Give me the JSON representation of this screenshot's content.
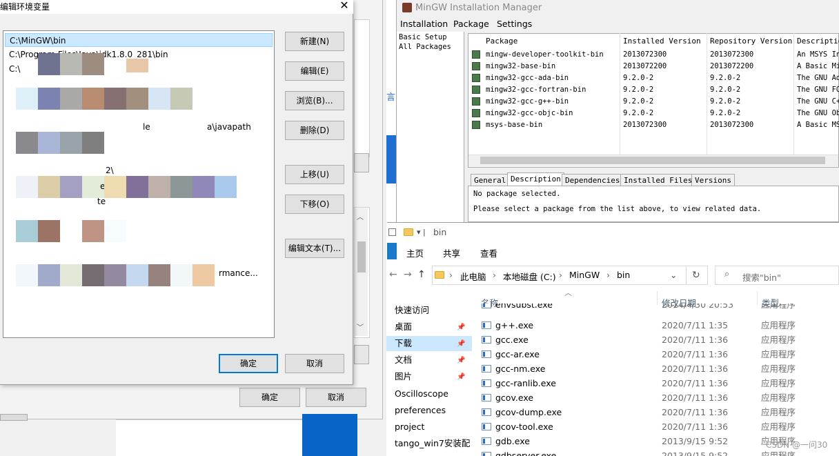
{
  "env_dialog": {
    "title": "编辑环境变量",
    "close_glyph": "✕",
    "paths": [
      "C:\\MinGW\\bin",
      "C:\\Program Files\\Java\\jdk1.8.0_281\\bin",
      "C:\\"
    ],
    "fragments": [
      "le",
      "a\\javapath",
      "2\\",
      "em",
      "te",
      "rmance..."
    ],
    "buttons": {
      "new": "新建(N)",
      "edit": "编辑(E)",
      "browse": "浏览(B)...",
      "delete": "删除(D)",
      "move_up": "上移(U)",
      "move_down": "下移(O)",
      "edit_text": "编辑文本(T)..."
    },
    "ok": "确定",
    "cancel": "取消"
  },
  "bg_dialog": {
    "ok": "确定",
    "cancel": "取消",
    "side_text": "言"
  },
  "mingw": {
    "title": "MinGW Installation Manager",
    "menu": [
      "Installation",
      "Package",
      "Settings"
    ],
    "categories": [
      "Basic Setup",
      "All Packages"
    ],
    "columns": [
      "Package",
      "Installed Version",
      "Repository Version",
      "Description"
    ],
    "packages": [
      {
        "name": "mingw-developer-toolkit-bin",
        "installed": "2013072300",
        "repo": "2013072300",
        "desc": "An MSYS In"
      },
      {
        "name": "mingw32-base-bin",
        "installed": "2013072200",
        "repo": "2013072200",
        "desc": "A Basic Mi"
      },
      {
        "name": "mingw32-gcc-ada-bin",
        "installed": "9.2.0-2",
        "repo": "9.2.0-2",
        "desc": "The GNU Ad"
      },
      {
        "name": "mingw32-gcc-fortran-bin",
        "installed": "9.2.0-2",
        "repo": "9.2.0-2",
        "desc": "The GNU FO"
      },
      {
        "name": "mingw32-gcc-g++-bin",
        "installed": "9.2.0-2",
        "repo": "9.2.0-2",
        "desc": "The GNU C+"
      },
      {
        "name": "mingw32-gcc-objc-bin",
        "installed": "9.2.0-2",
        "repo": "9.2.0-2",
        "desc": "The GNU Ob"
      },
      {
        "name": "msys-base-bin",
        "installed": "2013072300",
        "repo": "2013072300",
        "desc": "A Basic MS"
      }
    ],
    "tabs": [
      "General",
      "Description",
      "Dependencies",
      "Installed Files",
      "Versions"
    ],
    "detail_line1": "No package selected.",
    "detail_line2": "Please select a package from the list above, to view related data."
  },
  "explorer": {
    "title": "bin",
    "ribbon": [
      "主页",
      "共享",
      "查看"
    ],
    "breadcrumb": [
      "此电脑",
      "本地磁盘 (C:)",
      "MinGW",
      "bin"
    ],
    "search_placeholder": "搜索\"bin\"",
    "nav": [
      "快速访问",
      "桌面",
      "下载",
      "文档",
      "图片",
      "Oscilloscope",
      "preferences",
      "project",
      "tango_win7安装配"
    ],
    "columns": [
      "名称",
      "修改日期",
      "类型"
    ],
    "files": [
      {
        "name": "envsubst.exe",
        "date": "2014/4/30 20:53",
        "type": "应用程序"
      },
      {
        "name": "g++.exe",
        "date": "2020/7/11 1:35",
        "type": "应用程序"
      },
      {
        "name": "gcc.exe",
        "date": "2020/7/11 1:36",
        "type": "应用程序"
      },
      {
        "name": "gcc-ar.exe",
        "date": "2020/7/11 1:36",
        "type": "应用程序"
      },
      {
        "name": "gcc-nm.exe",
        "date": "2020/7/11 1:36",
        "type": "应用程序"
      },
      {
        "name": "gcc-ranlib.exe",
        "date": "2020/7/11 1:36",
        "type": "应用程序"
      },
      {
        "name": "gcov.exe",
        "date": "2020/7/11 1:36",
        "type": "应用程序"
      },
      {
        "name": "gcov-dump.exe",
        "date": "2020/7/11 1:36",
        "type": "应用程序"
      },
      {
        "name": "gcov-tool.exe",
        "date": "2020/7/11 1:36",
        "type": "应用程序"
      },
      {
        "name": "gdb.exe",
        "date": "2013/9/15 9:52",
        "type": "应用程序"
      },
      {
        "name": "gdbserver.exe",
        "date": "2013/9/15 9:52",
        "type": "应用程序"
      }
    ]
  },
  "watermark": "CSDN @一问30"
}
